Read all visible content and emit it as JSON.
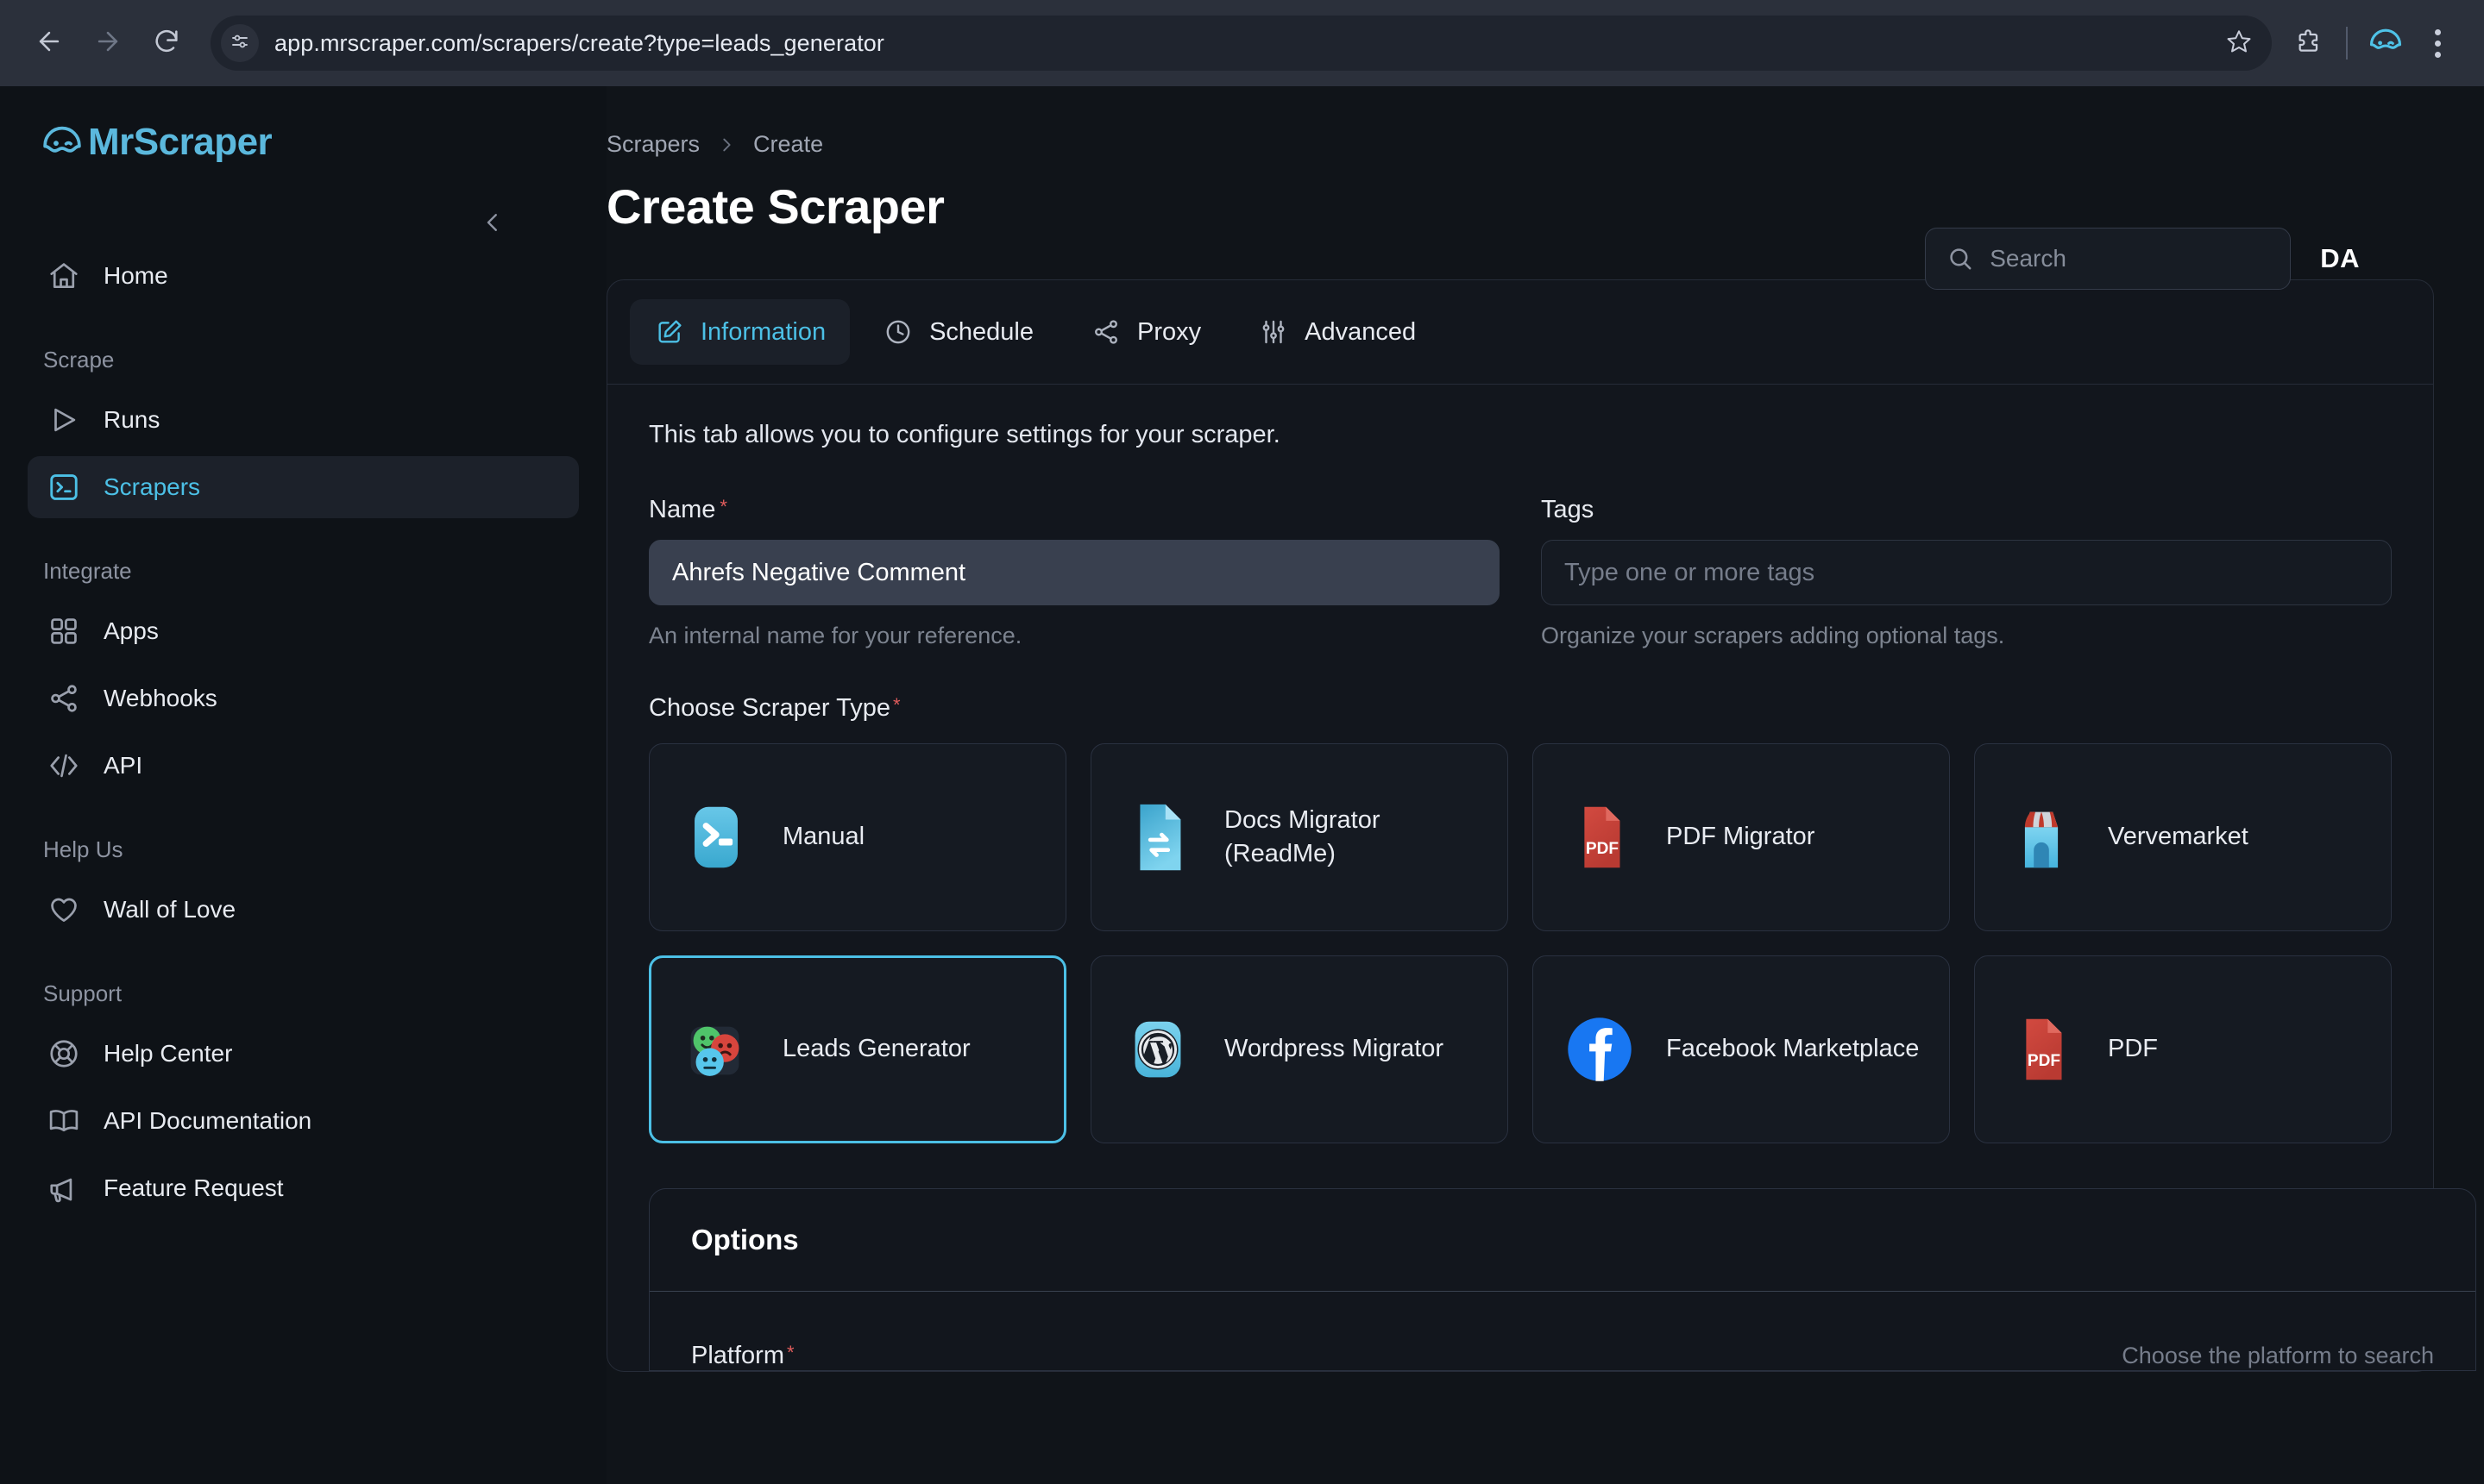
{
  "browser": {
    "url": "app.mrscraper.com/scrapers/create?type=leads_generator",
    "back_icon": "back-arrow-icon",
    "forward_icon": "forward-arrow-icon",
    "reload_icon": "reload-icon",
    "site_info_icon": "site-settings-icon",
    "bookmark_icon": "star-icon",
    "extensions_icon": "extensions-puzzle-icon",
    "profile_icon": "mrscraper-profile-icon",
    "menu_icon": "kebab-menu-icon"
  },
  "sidebar": {
    "brand": "MrScraper",
    "collapse_icon": "chevron-left-icon",
    "groups": [
      {
        "label": "",
        "items": [
          {
            "label": "Home",
            "icon": "home-icon",
            "active": false
          }
        ]
      },
      {
        "label": "Scrape",
        "items": [
          {
            "label": "Runs",
            "icon": "play-icon",
            "active": false
          },
          {
            "label": "Scrapers",
            "icon": "terminal-icon",
            "active": true
          }
        ]
      },
      {
        "label": "Integrate",
        "items": [
          {
            "label": "Apps",
            "icon": "grid-icon",
            "active": false
          },
          {
            "label": "Webhooks",
            "icon": "share-icon",
            "active": false
          },
          {
            "label": "API",
            "icon": "code-icon",
            "active": false
          }
        ]
      },
      {
        "label": "Help Us",
        "items": [
          {
            "label": "Wall of Love",
            "icon": "heart-icon",
            "active": false
          }
        ]
      },
      {
        "label": "Support",
        "items": [
          {
            "label": "Help Center",
            "icon": "lifebuoy-icon",
            "active": false
          },
          {
            "label": "API Documentation",
            "icon": "book-icon",
            "active": false
          },
          {
            "label": "Feature Request",
            "icon": "megaphone-icon",
            "active": false
          }
        ]
      }
    ]
  },
  "header": {
    "search_placeholder": "Search",
    "search_icon": "search-icon",
    "avatar_initials": "DA"
  },
  "breadcrumb": {
    "items": [
      "Scrapers",
      "Create"
    ],
    "separator_icon": "chevron-right-icon"
  },
  "page": {
    "title": "Create Scraper"
  },
  "tabs": [
    {
      "label": "Information",
      "icon": "edit-square-icon",
      "active": true
    },
    {
      "label": "Schedule",
      "icon": "clock-icon",
      "active": false
    },
    {
      "label": "Proxy",
      "icon": "share-icon",
      "active": false
    },
    {
      "label": "Advanced",
      "icon": "sliders-icon",
      "active": false
    }
  ],
  "information": {
    "intro": "This tab allows you to configure settings for your scraper.",
    "name": {
      "label": "Name",
      "required": "*",
      "value": "Ahrefs Negative Comment",
      "hint": "An internal name for your reference."
    },
    "tags": {
      "label": "Tags",
      "value": "",
      "placeholder": "Type one or more tags",
      "hint": "Organize your scrapers adding optional tags."
    },
    "scraper_type": {
      "label": "Choose Scraper Type",
      "required": "*",
      "cards": [
        {
          "label": "Manual",
          "icon": "terminal-badge-icon",
          "selected": false
        },
        {
          "label": "Docs Migrator (ReadMe)",
          "icon": "docs-migrator-icon",
          "selected": false
        },
        {
          "label": "PDF Migrator",
          "icon": "pdf-file-icon",
          "selected": false
        },
        {
          "label": "Vervemarket",
          "icon": "storefront-icon",
          "selected": false
        },
        {
          "label": "Leads Generator",
          "icon": "smiley-faces-icon",
          "selected": true
        },
        {
          "label": "Wordpress Migrator",
          "icon": "wordpress-icon",
          "selected": false
        },
        {
          "label": "Facebook Marketplace",
          "icon": "facebook-icon",
          "selected": false
        },
        {
          "label": "PDF",
          "icon": "pdf-file-icon",
          "selected": false
        }
      ]
    }
  },
  "options": {
    "title": "Options",
    "platform": {
      "label": "Platform",
      "required": "*",
      "hint": "Choose the platform to search"
    }
  },
  "colors": {
    "accent": "#4cc0e6",
    "brand": "#5bb8dd",
    "required": "#e05c5c",
    "page_bg": "#101419",
    "sidebar_bg": "#0e1217",
    "card_bg": "#12161d",
    "input_filled_bg": "#39404f"
  }
}
